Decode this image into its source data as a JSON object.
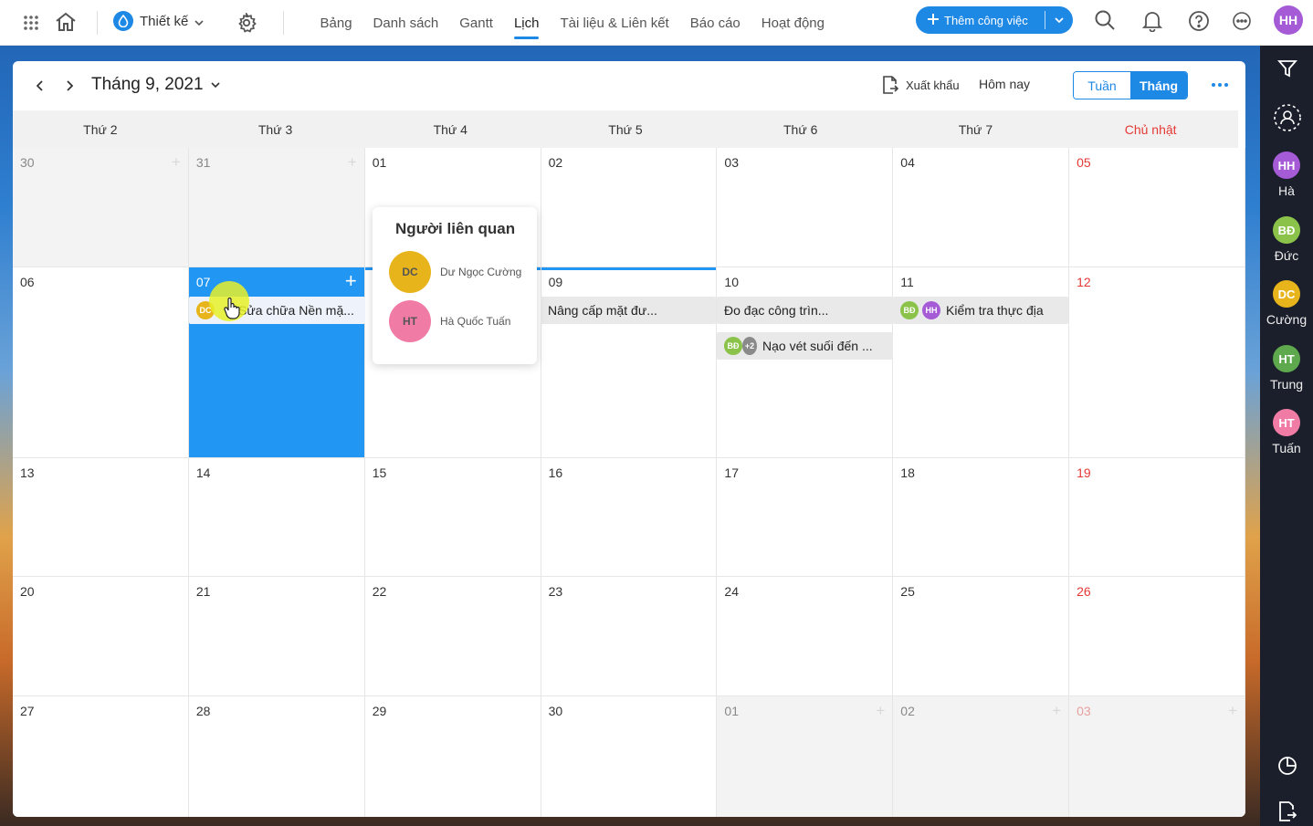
{
  "topbar": {
    "project_name": "Thiết kế",
    "tabs": [
      {
        "label": "Bảng",
        "active": false
      },
      {
        "label": "Danh sách",
        "active": false
      },
      {
        "label": "Gantt",
        "active": false
      },
      {
        "label": "Lịch",
        "active": true
      },
      {
        "label": "Tài liệu & Liên kết",
        "active": false
      },
      {
        "label": "Báo cáo",
        "active": false
      },
      {
        "label": "Hoạt động",
        "active": false
      }
    ],
    "add_button_label": "Thêm công việc",
    "user_initials": "HH",
    "user_color": "#a55ad6"
  },
  "calendar": {
    "month_title": "Tháng 9, 2021",
    "export_label": "Xuất khẩu",
    "today_label": "Hôm nay",
    "view_week_label": "Tuần",
    "view_month_label": "Tháng",
    "weekdays": [
      "Thứ 2",
      "Thứ 3",
      "Thứ 4",
      "Thứ 5",
      "Thứ 6",
      "Thứ 7",
      "Chủ nhật"
    ],
    "days": [
      "30",
      "31",
      "01",
      "02",
      "03",
      "04",
      "05",
      "06",
      "07",
      "08",
      "09",
      "10",
      "11",
      "12",
      "13",
      "14",
      "15",
      "16",
      "17",
      "18",
      "19",
      "20",
      "21",
      "22",
      "23",
      "24",
      "25",
      "26",
      "27",
      "28",
      "29",
      "30",
      "01",
      "02",
      "03"
    ],
    "selected_day_index": 8,
    "tasks": [
      {
        "label": "Sửa chữa Nền mặ...",
        "avatars": [
          "DC"
        ]
      },
      {
        "label": "Nâng cấp mặt đư...",
        "avatars": []
      },
      {
        "label": "Đo đạc công trìn...",
        "avatars": []
      },
      {
        "label": "Kiểm tra thực địa",
        "avatars": [
          "BĐ",
          "HH"
        ]
      },
      {
        "label": "Nạo vét suối đến ...",
        "avatars": [
          "BĐ",
          "+2"
        ]
      }
    ]
  },
  "popover": {
    "title": "Người liên quan",
    "people": [
      {
        "initials": "DC",
        "name": "Dư Ngọc Cường",
        "color": "#e8b41c"
      },
      {
        "initials": "HT",
        "name": "Hà Quốc Tuấn",
        "color": "#f07ca6"
      }
    ]
  },
  "members": [
    {
      "initials": "HH",
      "name": "Hà",
      "color": "#a55ad6"
    },
    {
      "initials": "BĐ",
      "name": "Đức",
      "color": "#8bc34a"
    },
    {
      "initials": "DC",
      "name": "Cường",
      "color": "#e8b41c"
    },
    {
      "initials": "HT",
      "name": "Trung",
      "color": "#5ea84e"
    },
    {
      "initials": "HT",
      "name": "Tuấn",
      "color": "#f07ca6"
    }
  ],
  "colors": {
    "accent": "#1e88e5",
    "sunday": "#e53935"
  }
}
